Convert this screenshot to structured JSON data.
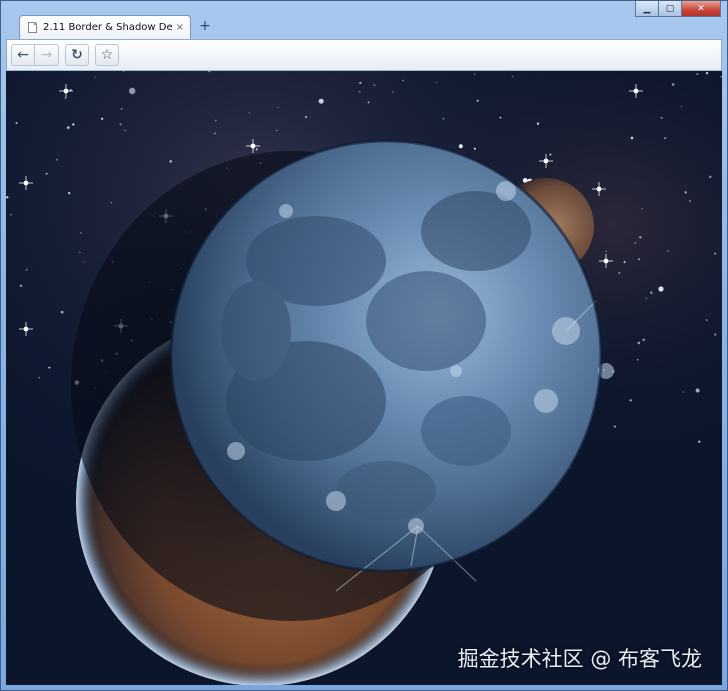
{
  "window": {
    "minimize_glyph": "▁",
    "maximize_glyph": "▢",
    "close_glyph": "✕"
  },
  "tab": {
    "title": "2.11 Border & Shadow De...",
    "close_glyph": "×",
    "new_tab_glyph": "+"
  },
  "toolbar": {
    "back_glyph": "←",
    "forward_glyph": "→",
    "reload_glyph": "↻",
    "star_glyph": "☆"
  },
  "content": {
    "image_subject": "blue moon in front of red planet on starfield",
    "watermark": "掘金技术社区 @ 布客飞龙"
  },
  "colors": {
    "frame": "#8db6e6",
    "space": "#0c1730",
    "moon": "#6d93c0",
    "planet": "#8a5a3a"
  }
}
